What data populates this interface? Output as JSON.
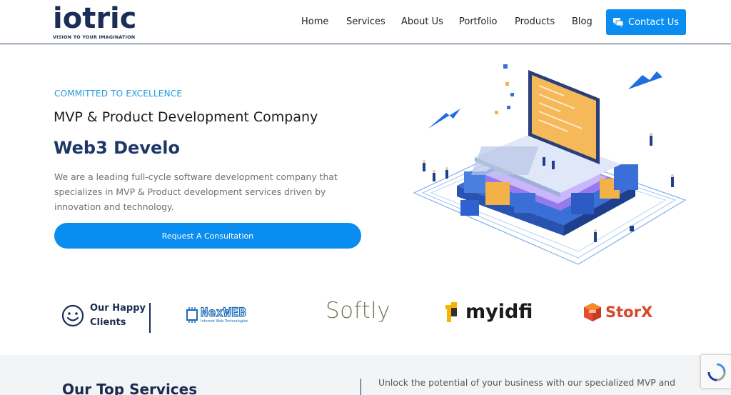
{
  "header": {
    "logo_text": "iotric",
    "logo_tagline": "VISION TO YOUR IMAGINATION",
    "nav": [
      "Home",
      "Services",
      "About Us",
      "Portfolio",
      "Products",
      "Blog"
    ],
    "contact_label": "Contact Us",
    "accent": "#0a8df0",
    "brand": "#1c2e57"
  },
  "hero": {
    "eyebrow": "COMMITTED TO EXCELLENCE",
    "title": "MVP & Product Development Company",
    "typed": "Web3 Develo",
    "description": "We are a leading full-cycle software development company that specializes in MVP & Product development services driven by innovation and technology.",
    "cta_label": "Request A Consultation"
  },
  "clients": {
    "label_line1": "Our Happy",
    "label_line2": "Clients",
    "logos": {
      "nexweb": "NexWEB",
      "nexweb_sub": "Internet Web Technologies",
      "softly": "Softly",
      "myidfi": "myidfi",
      "storx": "StorX"
    }
  },
  "services": {
    "title": "Our Top Services",
    "description": "Unlock the potential of your business with our specialized MVP and"
  }
}
